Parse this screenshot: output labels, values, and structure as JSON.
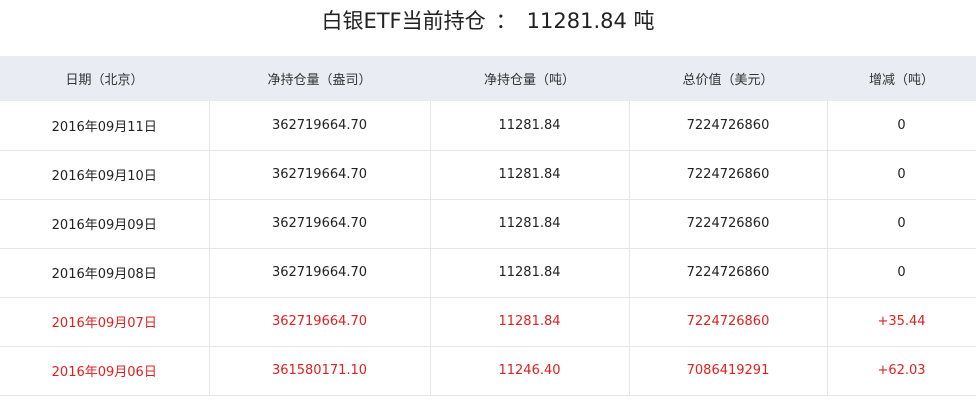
{
  "title": {
    "label": "白银ETF当前持仓",
    "separator": "：",
    "value": "11281.84 吨"
  },
  "table": {
    "headers": [
      "日期（北京）",
      "净持仓量（盎司）",
      "净持仓量（吨）",
      "总价值（美元）",
      "增减（吨）"
    ],
    "rows": [
      [
        "2016年09月11日",
        "362719664.70",
        "11281.84",
        "7224726860",
        "0"
      ],
      [
        "2016年09月10日",
        "362719664.70",
        "11281.84",
        "7224726860",
        "0"
      ],
      [
        "2016年09月09日",
        "362719664.70",
        "11281.84",
        "7224726860",
        "0"
      ],
      [
        "2016年09月08日",
        "362719664.70",
        "11281.84",
        "7224726860",
        "0"
      ],
      [
        "2016年09月07日",
        "362719664.70",
        "11281.84",
        "7224726860",
        "+35.44"
      ],
      [
        "2016年09月06日",
        "361580171.10",
        "11246.40",
        "7086419291",
        "+62.03"
      ]
    ]
  },
  "colors": {
    "increase": "#e02020",
    "neutral": "#222222",
    "header_bg": "#e9ecf3"
  }
}
